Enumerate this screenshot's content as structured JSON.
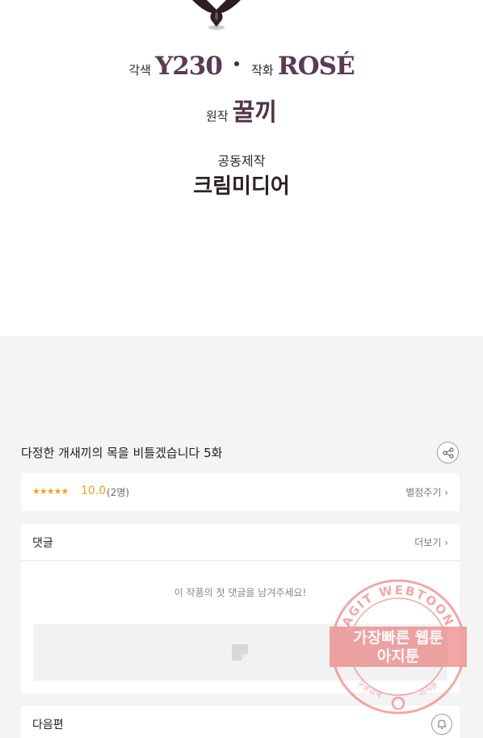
{
  "credits": {
    "adapt_label": "각색",
    "adapt_name": "Y230",
    "art_label": "작화",
    "art_name": "ROSÉ",
    "original_label": "원작",
    "original_name": "꿀끼",
    "coprod_label": "공동제작",
    "coprod_name": "크림미디어"
  },
  "episode": {
    "title": "다정한 개새끼의 목을 비틀겠습니다 5화",
    "share_icon": "share-icon"
  },
  "rating": {
    "stars": "★★★★★",
    "value": "10.0",
    "count": "(2명)",
    "rate_link": "별점주기 ›"
  },
  "comments": {
    "title": "댓글",
    "more": "더보기 ›",
    "empty_message": "이 작품의 첫 댓글을 남겨주세요!"
  },
  "next": {
    "title": "다음편",
    "icon": "bell-icon"
  },
  "watermark": {
    "arc_text": "AGIT WEBTOON",
    "line1": "가장빠른 웹툰",
    "line2": "아지툰",
    "left_small": "구글검색",
    "right_small": "아지툰"
  },
  "colors": {
    "accent_star": "#f0a01e",
    "watermark": "#e8605f"
  }
}
